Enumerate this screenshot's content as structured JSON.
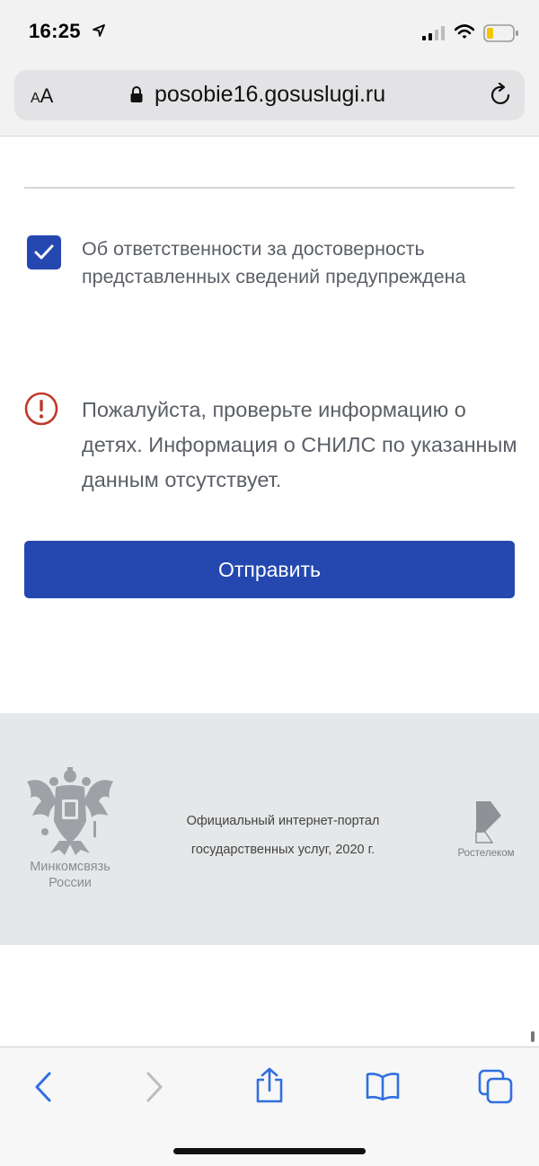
{
  "status_bar": {
    "time": "16:25",
    "location_icon": "location-arrow-icon",
    "signal_icon": "cellular-signal-icon",
    "wifi_icon": "wifi-icon",
    "battery_icon": "battery-low-icon"
  },
  "browser": {
    "text_size_label_small": "A",
    "text_size_label_large": "A",
    "url": "posobie16.gosuslugi.ru",
    "lock_icon": "lock-icon",
    "reload_icon": "reload-icon"
  },
  "form": {
    "checkbox_checked": true,
    "checkbox_label": "Об ответственности за достоверность представленных сведений предупреждена",
    "warning_text": "Пожалуйста, проверьте информацию о детях. Информация о СНИЛС по указанным данным отсутствует.",
    "submit_label": "Отправить"
  },
  "footer": {
    "ministry_line1": "Минкомсвязь",
    "ministry_line2": "России",
    "portal_line1": "Официальный интернет-портал",
    "portal_line2": "государственных услуг, 2020 г.",
    "operator_name": "Ростелеком"
  },
  "toolbar": {
    "back_icon": "chevron-left-icon",
    "forward_icon": "chevron-right-icon",
    "share_icon": "share-icon",
    "bookmarks_icon": "book-icon",
    "tabs_icon": "tabs-icon"
  },
  "colors": {
    "primary": "#2448b0",
    "warning": "#c0392b",
    "text_secondary": "#5b5f66",
    "footer_bg": "#e5e7e8",
    "ios_blue": "#2f6fe0"
  }
}
